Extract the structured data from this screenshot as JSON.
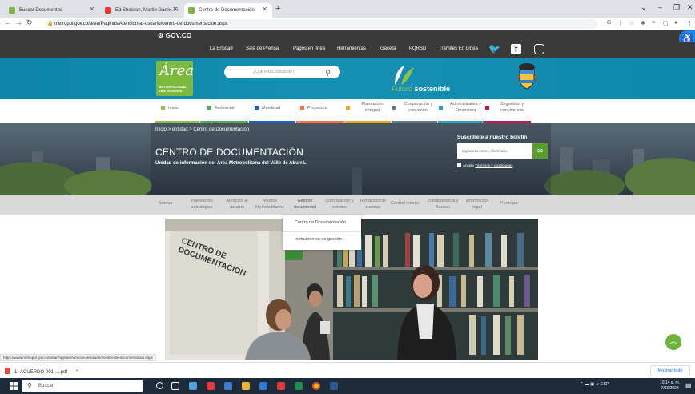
{
  "browser": {
    "tabs": [
      {
        "title": "Buscar Documentos",
        "favicon_color": "#7cb342"
      },
      {
        "title": "Ed Sheeran, Martin Garrix, Fi",
        "favicon_color": "#e53935"
      },
      {
        "title": "Centro de Documentación",
        "favicon_color": "#7cb342"
      }
    ],
    "url": "metropol.gov.co/area/Paginas/Atencion-al-usuario/centro-de-documentacion.aspx"
  },
  "site": {
    "gov_logo": "GOV.CO",
    "top_nav": [
      "La Entidad",
      "Sala de Prensa",
      "Pagos en línea",
      "Herramientas",
      "Gaceta",
      "PQRSD",
      "Trámites En Línea"
    ],
    "search_placeholder": "¿Qué estás buscando?",
    "logo_script": "Área",
    "logo_sub_line1": "METROPOLITANA",
    "logo_sub_line2": "Valle de Aburrá",
    "futuro_word": "Futuro",
    "sostenible_word": "sostenible",
    "categories": [
      {
        "label": "Inicio",
        "color": "#8bc34a"
      },
      {
        "label": "Ambiental",
        "color": "#4caf50"
      },
      {
        "label": "Movilidad",
        "color": "#1e63c8"
      },
      {
        "label": "Proyectos",
        "color": "#ff7043"
      },
      {
        "label": "Planeación integral",
        "color": "#f5a623"
      },
      {
        "label": "Cooperación y convenios",
        "color": "#607d8b"
      },
      {
        "label": "Administrativa y Financiera",
        "color": "#29a3d1"
      },
      {
        "label": "Seguridad y convivencia",
        "color": "#c2185b"
      }
    ],
    "breadcrumb": "Inicio > entidad > Centro de Documentación",
    "hero_title": "CENTRO DE DOCUMENTACIÓN",
    "hero_subtitle": "Unidad de información del Área Metropolitana del Valle de Aburrá.",
    "subscribe_title": "Suscríbete a nuestro boletín",
    "email_placeholder": "Ingresa tu correo electrónico",
    "terms_prefix": "Acepto",
    "terms_link": "Términos y condiciones",
    "sub_nav": [
      "Somos",
      "Planeación estratégica",
      "Atención al usuario",
      "Medios Metropolitanos",
      "Gestión documental",
      "Contratación y empleo",
      "Rendición de cuentas",
      "Control interno",
      "Transparencia y Acceso",
      "Información legal",
      "Participa"
    ],
    "dropdown": [
      "Centro de Documentación",
      "Instrumentos de gestión"
    ],
    "photo_sign": "CENTRO DE DOCUMENTACIÓN",
    "status_url": "https://www.metropol.gov.co/area/Paginas/Atencion-al-usuario/centro-de-documentacion.aspx"
  },
  "downloads": {
    "file": "1.-ACUERDO-001-....pdf",
    "show_all": "Mostrar todo"
  },
  "taskbar": {
    "search_placeholder": "Buscar",
    "lang": "ESP",
    "time": "10:14 a. m.",
    "date": "7/03/2023"
  }
}
